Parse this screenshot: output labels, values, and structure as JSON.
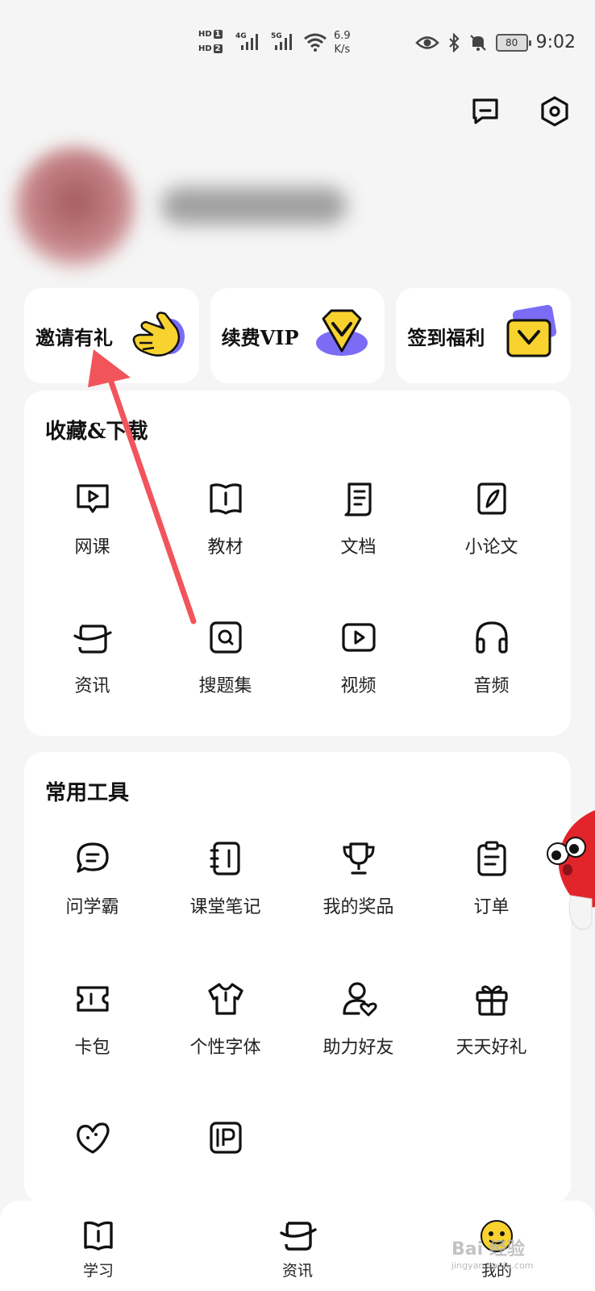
{
  "status_bar": {
    "hd1": "HD",
    "hd1_num": "1",
    "hd2": "HD",
    "hd2_num": "2",
    "net1": "4G",
    "net2": "5G",
    "speed_value": "6.9",
    "speed_unit": "K/s",
    "battery": "80",
    "time": "9:02"
  },
  "quick_actions": [
    {
      "label": "邀请有礼",
      "icon": "waving-hand-icon"
    },
    {
      "label": "续费VIP",
      "icon": "vip-badge-icon"
    },
    {
      "label": "签到福利",
      "icon": "checkin-gift-icon"
    }
  ],
  "favorites": {
    "title": "收藏&下载",
    "items": [
      {
        "label": "网课",
        "icon": "video-course-icon"
      },
      {
        "label": "教材",
        "icon": "book-icon"
      },
      {
        "label": "文档",
        "icon": "document-icon"
      },
      {
        "label": "小论文",
        "icon": "pen-paper-icon"
      },
      {
        "label": "资讯",
        "icon": "news-icon"
      },
      {
        "label": "搜题集",
        "icon": "search-question-icon"
      },
      {
        "label": "视频",
        "icon": "video-icon"
      },
      {
        "label": "音频",
        "icon": "headphones-icon"
      }
    ]
  },
  "tools": {
    "title": "常用工具",
    "items": [
      {
        "label": "问学霸",
        "icon": "chat-bubble-icon"
      },
      {
        "label": "课堂笔记",
        "icon": "notebook-icon"
      },
      {
        "label": "我的奖品",
        "icon": "trophy-icon"
      },
      {
        "label": "订单",
        "icon": "clipboard-icon"
      },
      {
        "label": "卡包",
        "icon": "ticket-icon"
      },
      {
        "label": "个性字体",
        "icon": "tshirt-icon"
      },
      {
        "label": "助力好友",
        "icon": "user-heart-icon"
      },
      {
        "label": "天天好礼",
        "icon": "gift-icon"
      },
      {
        "label": "",
        "icon": "heart-face-icon"
      },
      {
        "label": "",
        "icon": "parking-icon"
      }
    ]
  },
  "bottom_nav": [
    {
      "label": "学习",
      "icon": "book-tab-icon"
    },
    {
      "label": "资讯",
      "icon": "news-tab-icon"
    },
    {
      "label": "我的",
      "icon": "smiley-tab-icon"
    }
  ],
  "watermark": {
    "text": "Bai 经验",
    "sub": "jingyan.baidu.com"
  },
  "colors": {
    "accent_yellow": "#f8d22e",
    "accent_purple": "#7b6cf6",
    "arrow_red": "#f2545b",
    "background": "#f5f5f5"
  }
}
